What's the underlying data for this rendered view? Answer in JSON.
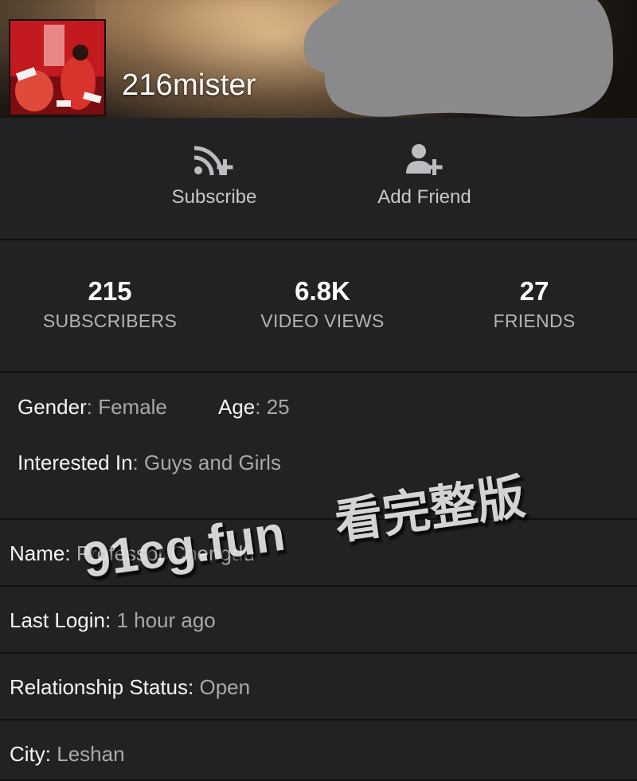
{
  "profile": {
    "username": "216mister"
  },
  "actions": {
    "subscribe_label": "Subscribe",
    "add_friend_label": "Add Friend"
  },
  "stats": [
    {
      "value": "215",
      "label": "SUBSCRIBERS"
    },
    {
      "value": "6.8K",
      "label": "VIDEO VIEWS"
    },
    {
      "value": "27",
      "label": "FRIENDS"
    }
  ],
  "info": {
    "gender_key": "Gender",
    "gender_value": "Female",
    "age_key": "Age",
    "age_value": "25",
    "interested_key": "Interested In",
    "interested_value": "Guys and Girls"
  },
  "details": [
    {
      "key": "Name",
      "value": "Professor Chengdu"
    },
    {
      "key": "Last Login",
      "value": "1 hour ago"
    },
    {
      "key": "Relationship Status",
      "value": "Open"
    },
    {
      "key": "City",
      "value": "Leshan"
    }
  ],
  "watermark": {
    "line1": "91cg.fun",
    "line2": "看完整版"
  },
  "colors": {
    "background": "#1e1e20",
    "panel": "#222225",
    "divider": "#111113",
    "value_text": "#a9a9ad",
    "redaction": "#8a8a8c",
    "avatar_red": "#c21a1f"
  },
  "icons": {
    "subscribe": "rss-plus-icon",
    "add_friend": "user-plus-icon"
  }
}
